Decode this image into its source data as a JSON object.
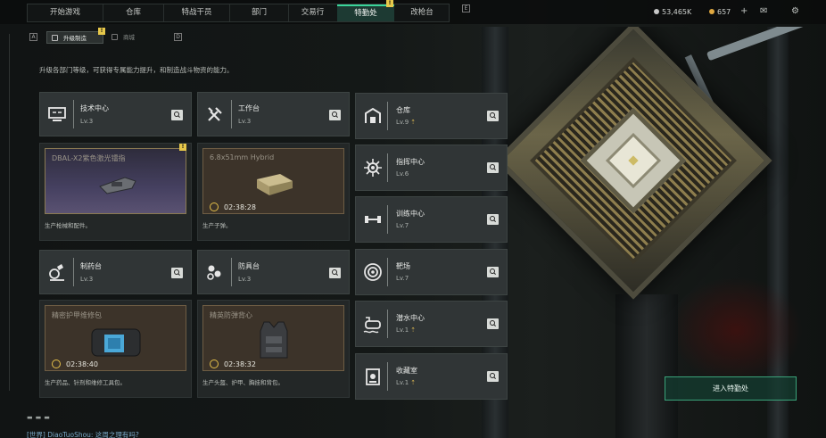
{
  "nav": {
    "tabs": [
      "开始游戏",
      "仓库",
      "特战干员",
      "部门",
      "交易行",
      "特勤处",
      "改枪台"
    ],
    "active_tab": "特勤处",
    "badge": "!"
  },
  "currency": {
    "coins": "53,465K",
    "tokens": "657",
    "plus": "+"
  },
  "subtabs": {
    "active": "升级制造",
    "other": "商城",
    "badge": "!"
  },
  "description": "升级各部门等级，可获得专属能力提升，和制造战斗物资的能力。",
  "cards": [
    {
      "name": "技术中心",
      "level": "Lv.3",
      "icon": "monitor-icon",
      "product": "DBAL-X2紫色激光镭指",
      "timer": "",
      "footer": "生产枪械和配件。",
      "badge": "!"
    },
    {
      "name": "工作台",
      "level": "Lv.3",
      "icon": "tools-icon",
      "product": "6.8x51mm Hybrid",
      "timer": "02:38:28",
      "footer": "生产子弹。",
      "badge": ""
    },
    {
      "name": "制药台",
      "level": "Lv.3",
      "icon": "microscope-icon",
      "product": "精密护甲维修包",
      "timer": "02:38:40",
      "footer": "生产药品、针剂和维修工具包。",
      "badge": ""
    },
    {
      "name": "防具台",
      "level": "Lv.3",
      "icon": "armor-icon",
      "product": "精英防弹背心",
      "timer": "02:38:32",
      "footer": "生产头盔、护甲、胸挂和背包。",
      "badge": ""
    }
  ],
  "side_items": [
    {
      "name": "仓库",
      "level": "Lv.9",
      "upgrade": true,
      "icon": "warehouse-icon"
    },
    {
      "name": "指挥中心",
      "level": "Lv.6",
      "upgrade": false,
      "icon": "command-icon"
    },
    {
      "name": "训练中心",
      "level": "Lv.7",
      "upgrade": false,
      "icon": "dumbbell-icon"
    },
    {
      "name": "靶场",
      "level": "Lv.7",
      "upgrade": false,
      "icon": "target-icon"
    },
    {
      "name": "潜水中心",
      "level": "Lv.1",
      "upgrade": true,
      "icon": "diving-icon"
    },
    {
      "name": "收藏室",
      "level": "Lv.1",
      "upgrade": true,
      "icon": "collection-icon"
    }
  ],
  "enter_button": "进入特勤处",
  "chat": "[世界] DiaoTuoShou: 这周之理有吗?",
  "key_hints": {
    "left": "Q",
    "right": "E",
    "sub_left": "A",
    "sub_right": "D"
  }
}
